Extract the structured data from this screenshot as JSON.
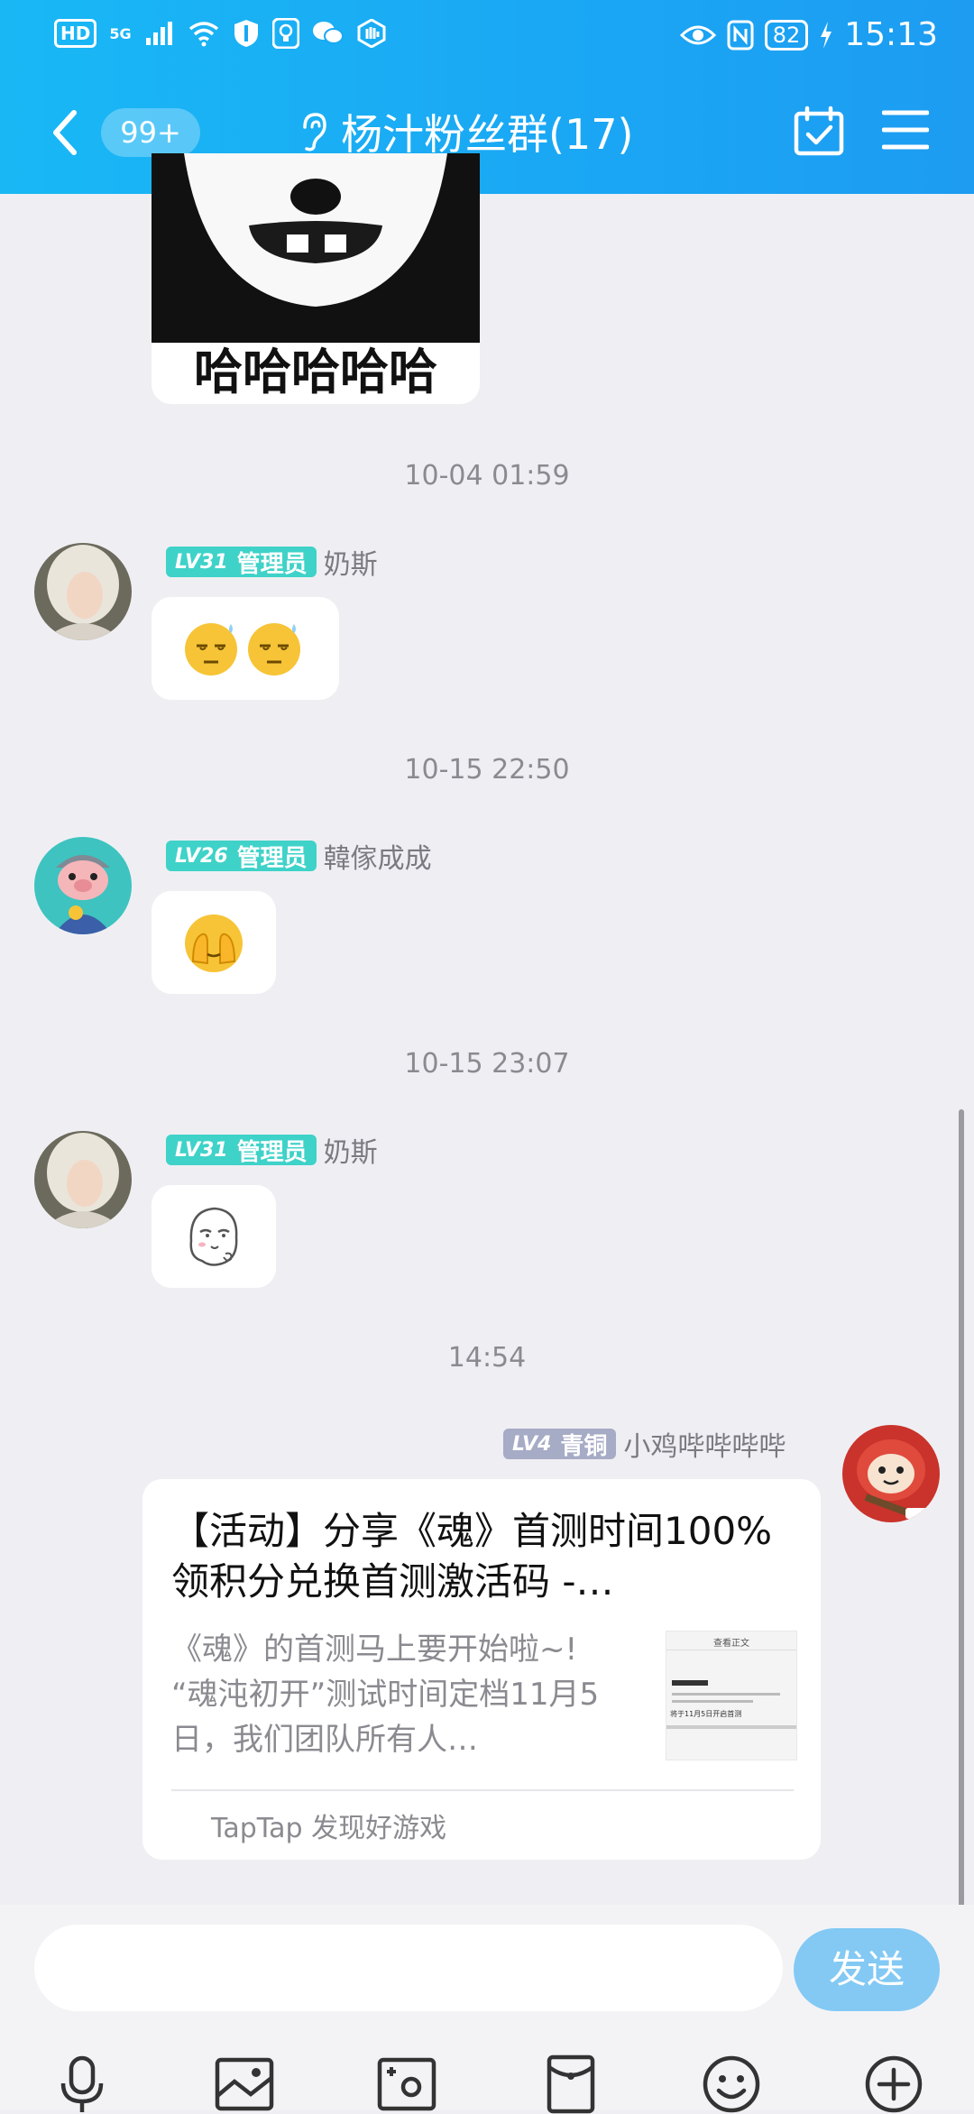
{
  "status_bar": {
    "left_hd": "HD",
    "left_net": "5G",
    "battery": "82",
    "time": "15:13"
  },
  "header": {
    "back_count": "99+",
    "title": "杨汁粉丝群(17)"
  },
  "messages": [
    {
      "sticker_caption": "哈哈哈哈哈"
    },
    {
      "timestamp": "10-04 01:59",
      "level": "LV31",
      "role": "管理员",
      "nickname": "奶斯",
      "content_icon": "sweat-emoji-pair"
    },
    {
      "timestamp": "10-15 22:50",
      "level": "LV26",
      "role": "管理员",
      "nickname": "韓傢成成",
      "content_icon": "facepalm-emoji"
    },
    {
      "timestamp": "10-15 23:07",
      "level": "LV31",
      "role": "管理员",
      "nickname": "奶斯",
      "content_icon": "ghost-sticker"
    },
    {
      "timestamp": "14:54",
      "level": "LV4",
      "role": "青铜",
      "nickname": "小鸡哔哔哔哔",
      "card": {
        "title": "【活动】分享《魂》首测时间100%领积分兑换首测激活码 -…",
        "description": "《魂》的首测马上要开始啦~! “魂沌初开”测试时间定档11月5日，我们团队所有人…",
        "thumb_heading": "查看正文",
        "thumb_caption": "将于11月5日开启首测",
        "source": "TapTap 发现好游戏"
      }
    }
  ],
  "input": {
    "placeholder": "",
    "send_label": "发送"
  },
  "toolbar": [
    "microphone-icon",
    "image-icon",
    "camera-icon",
    "red-packet-icon",
    "emoji-icon",
    "plus-icon"
  ],
  "colors": {
    "header": "#1aa8f4",
    "admin_badge": "#3fd2c8",
    "bronze_badge": "#a6abc6",
    "send_button": "#83c9f4"
  }
}
